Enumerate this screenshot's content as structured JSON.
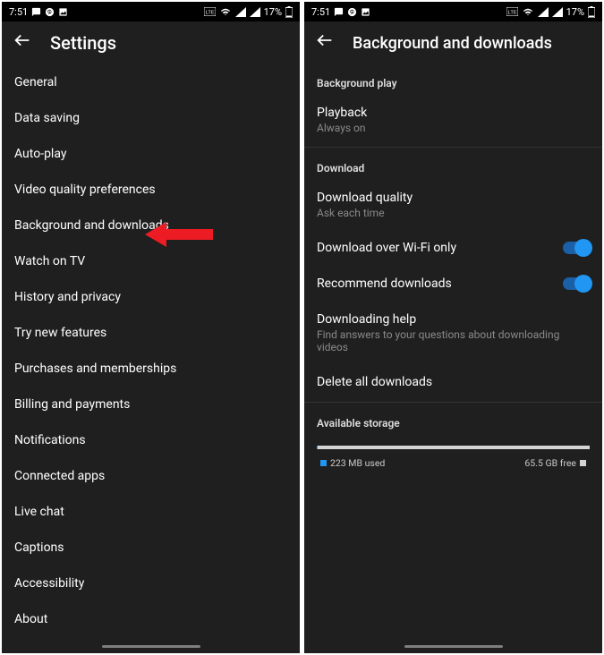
{
  "status": {
    "time": "7:51",
    "battery": "17%"
  },
  "left": {
    "title": "Settings",
    "items": [
      "General",
      "Data saving",
      "Auto-play",
      "Video quality preferences",
      "Background and downloads",
      "Watch on TV",
      "History and privacy",
      "Try new features",
      "Purchases and memberships",
      "Billing and payments",
      "Notifications",
      "Connected apps",
      "Live chat",
      "Captions",
      "Accessibility",
      "About"
    ]
  },
  "right": {
    "title": "Background and downloads",
    "sections": {
      "bgplay": "Background play",
      "download": "Download",
      "storage": "Available storage"
    },
    "playback": {
      "primary": "Playback",
      "secondary": "Always on"
    },
    "quality": {
      "primary": "Download quality",
      "secondary": "Ask each time"
    },
    "wifi": {
      "primary": "Download over Wi-Fi only",
      "on": true
    },
    "recommend": {
      "primary": "Recommend downloads",
      "on": true
    },
    "help": {
      "primary": "Downloading help",
      "secondary": "Find answers to your questions about downloading videos"
    },
    "delete": {
      "primary": "Delete all downloads"
    },
    "storage": {
      "used_label": "223 MB used",
      "free_label": "65.5 GB free",
      "used_pct": 0.4
    }
  }
}
